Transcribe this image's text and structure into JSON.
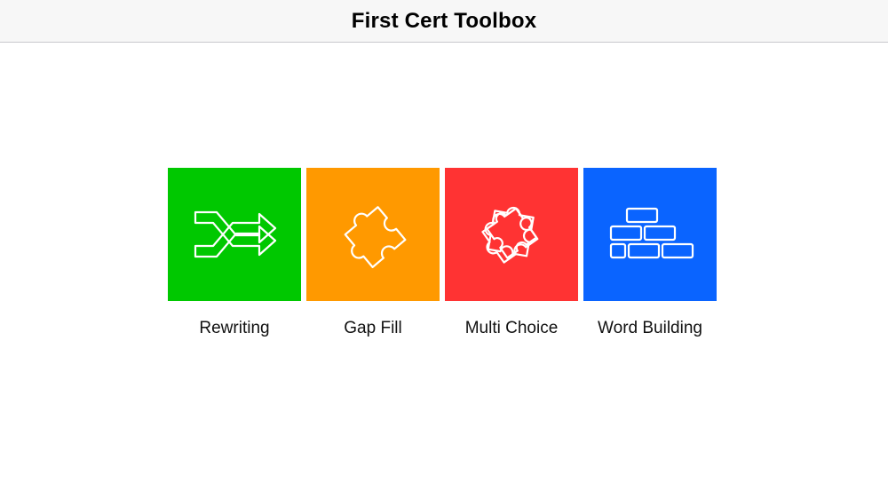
{
  "navbar": {
    "title": "First Cert Toolbox"
  },
  "tiles": [
    {
      "label": "Rewriting",
      "icon": "shuffle-arrows-icon",
      "color": "#00c800"
    },
    {
      "label": "Gap Fill",
      "icon": "puzzle-piece-icon",
      "color": "#ff9900"
    },
    {
      "label": "Multi Choice",
      "icon": "puzzle-cluster-icon",
      "color": "#ff3333"
    },
    {
      "label": "Word Building",
      "icon": "brick-wall-icon",
      "color": "#0a64ff"
    }
  ]
}
